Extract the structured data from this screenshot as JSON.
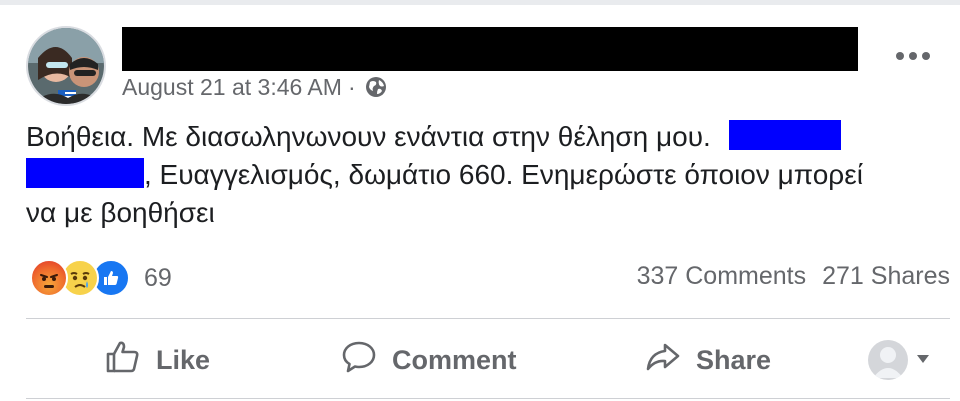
{
  "post": {
    "timestamp": "August 21 at 3:46 AM",
    "separator": "·",
    "privacy_icon": "globe-icon",
    "text_lines": [
      "Βοήθεια. Με διασωληνωνουν ενάντια στην θέληση μου.",
      ", Ευαγγελισμός, δωμάτιο 660. Ενημερώστε όποιον μπορεί",
      "να με βοηθήσει"
    ]
  },
  "reactions": {
    "icons": [
      "angry-reaction-icon",
      "sad-reaction-icon",
      "like-reaction-icon"
    ],
    "count": "69"
  },
  "stats": {
    "comments": "337 Comments",
    "shares": "271 Shares"
  },
  "actions": {
    "like": "Like",
    "comment": "Comment",
    "share": "Share"
  },
  "colors": {
    "redaction_name": "#000000",
    "redaction_text": "#0000ff",
    "muted": "#65676b",
    "like_blue": "#1877f2"
  }
}
